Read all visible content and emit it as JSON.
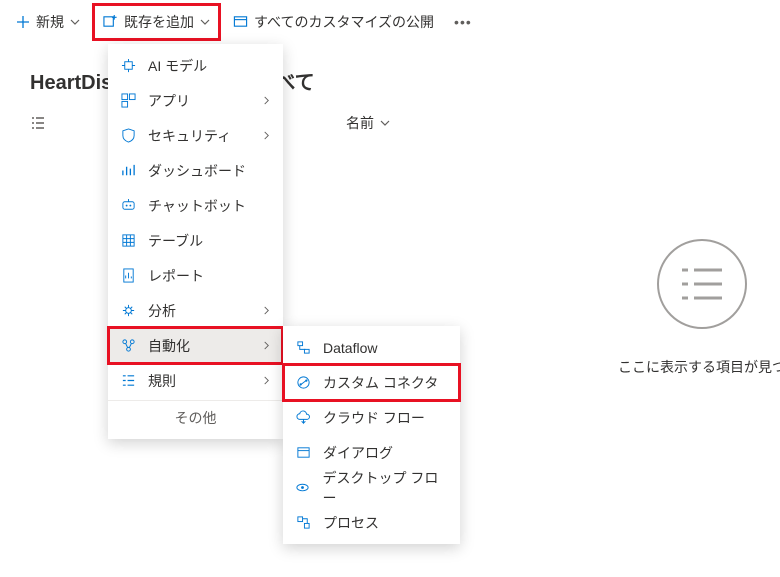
{
  "toolbar": {
    "new": "新規",
    "add_existing": "既存を追加",
    "publish_all": "すべてのカスタマイズの公開",
    "more": "•••"
  },
  "page_title_prefix": "HeartDis",
  "page_title_suffix": "べて",
  "column_name": "名前",
  "empty_state": "ここに表示する項目が見つ",
  "dropdown": {
    "ai_model": "AI モデル",
    "app": "アプリ",
    "security": "セキュリティ",
    "dashboard": "ダッシュボード",
    "chatbot": "チャットボット",
    "table": "テーブル",
    "report": "レポート",
    "analysis": "分析",
    "automation": "自動化",
    "rules": "規則",
    "other": "その他"
  },
  "submenu": {
    "dataflow": "Dataflow",
    "custom_connector": "カスタム コネクタ",
    "cloud_flow": "クラウド フロー",
    "dialog": "ダイアログ",
    "desktop_flow": "デスクトップ フロー",
    "process": "プロセス"
  }
}
